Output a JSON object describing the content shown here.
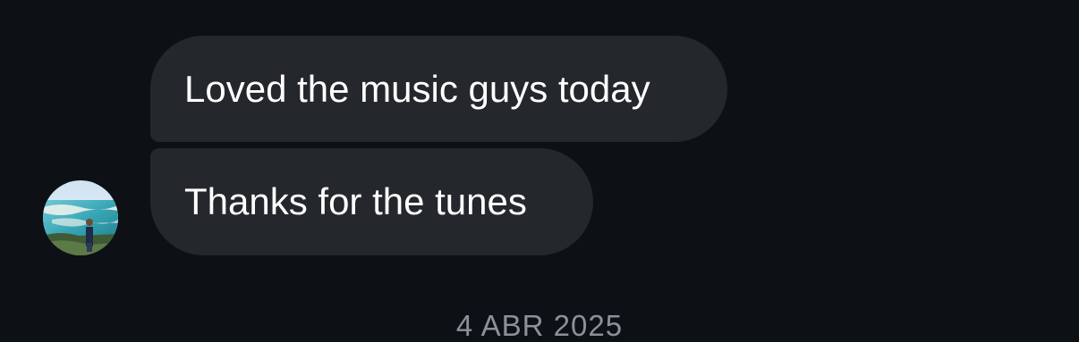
{
  "thread": {
    "messages": [
      {
        "text": "Loved the music guys today"
      },
      {
        "text": "Thanks for the tunes"
      }
    ],
    "date_separator": "4 ABR 2025"
  },
  "colors": {
    "background": "#0d1014",
    "bubble": "#24272b",
    "text": "#ffffff",
    "date_text": "#8b9199"
  },
  "icons": {
    "avatar": "profile-photo-beach"
  }
}
